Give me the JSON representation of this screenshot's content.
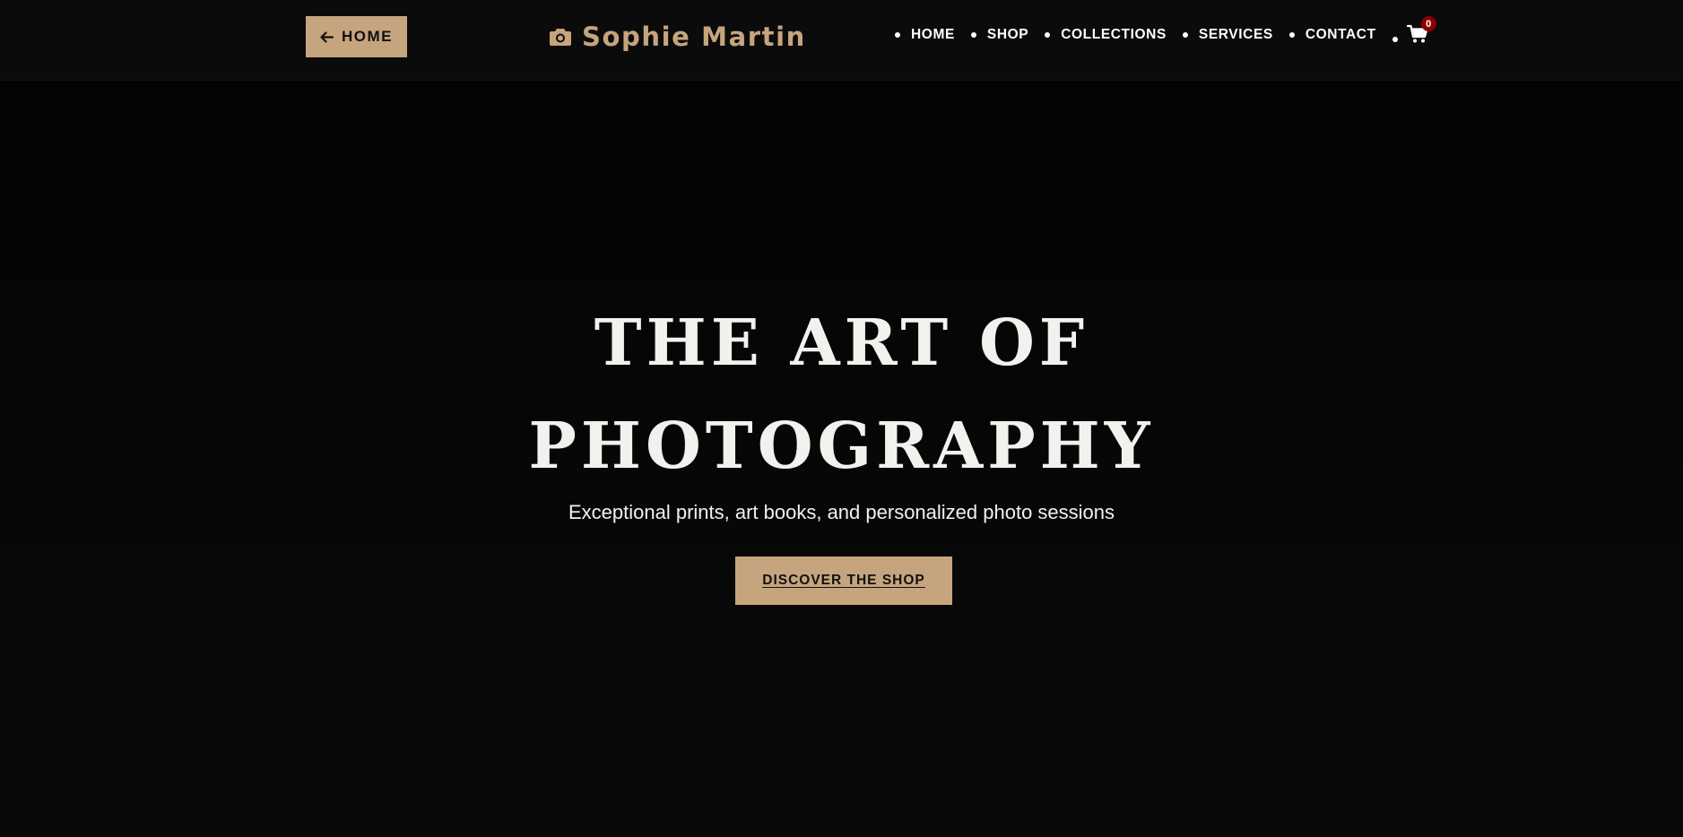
{
  "header": {
    "home_button_label": "HOME",
    "brand_name": "Sophie Martin",
    "nav_items": [
      "HOME",
      "SHOP",
      "COLLECTIONS",
      "SERVICES",
      "CONTACT"
    ],
    "cart_count": "0"
  },
  "hero": {
    "title_line1": "THE ART OF",
    "title_line2": "PHOTOGRAPHY",
    "subtitle": "Exceptional prints, art books, and personalized photo sessions",
    "cta_label": "DISCOVER THE SHOP"
  },
  "colors": {
    "background": "#050505",
    "header_background": "#0b0b0b",
    "accent": "#c6a47e",
    "badge": "#8b0000",
    "text": "#f3f1ee"
  },
  "icons": {
    "home_button": "arrow-left-icon",
    "brand": "camera-icon",
    "cart": "shopping-cart-icon"
  }
}
